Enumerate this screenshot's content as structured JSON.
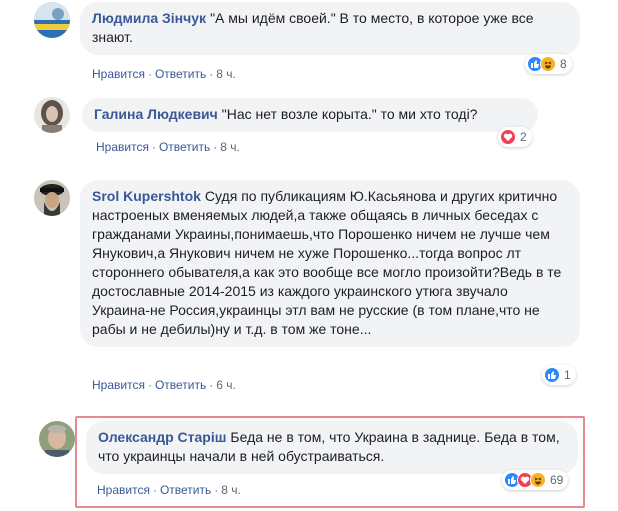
{
  "colors": {
    "author": "#385898",
    "bubble_bg": "#f2f3f5",
    "meta": "#606770",
    "like": "#2d88ff",
    "love": "#f33e58",
    "haha": "#f7b125",
    "highlight_border": "#e68a8f"
  },
  "action_labels": {
    "like": "Нравится",
    "reply": "Ответить",
    "separator": "·"
  },
  "comments": [
    {
      "author": "Людмила Зінчук",
      "text": "\"А мы идём своей.\" В то место, в которое уже все знают.",
      "time": "8 ч.",
      "reactions": [
        "like-icon",
        "haha-icon"
      ],
      "reaction_count": "8"
    },
    {
      "author": "Галина Людкевич",
      "text": "\"Нас нет возле корыта.\" то ми хто тоді?",
      "time": "8 ч.",
      "reactions": [
        "love-icon"
      ],
      "reaction_count": "2"
    },
    {
      "author": "Srol Kupershtok",
      "text": "Судя по публикациям Ю.Касьянова и других критично настроеных вменяемых людей,а также общаясь в личных беседах с гражданами Украины,понимаешь,что Порошенко ничем не лучше чем Янукович,а Янукович ничем не хуже Порошенко...тогда вопрос лт стороннего обывателя,а как это вообще все могло произойти?Ведь в те достославные 2014-2015 из каждого украинского утюга звучало Украина-не Россия,украинцы этл вам не русские (в том плане,что не рабы и не дебилы)ну и т.д. в том же тоне...",
      "time": "6 ч.",
      "reactions": [
        "like-icon"
      ],
      "reaction_count": "1"
    },
    {
      "author": "Олександр Старіш",
      "text": "Беда не в том, что Украина в заднице. Беда в том, что украинцы начали в ней обустраиваться.",
      "time": "8 ч.",
      "reactions": [
        "like-icon",
        "love-icon",
        "haha-icon"
      ],
      "reaction_count": "69"
    }
  ]
}
